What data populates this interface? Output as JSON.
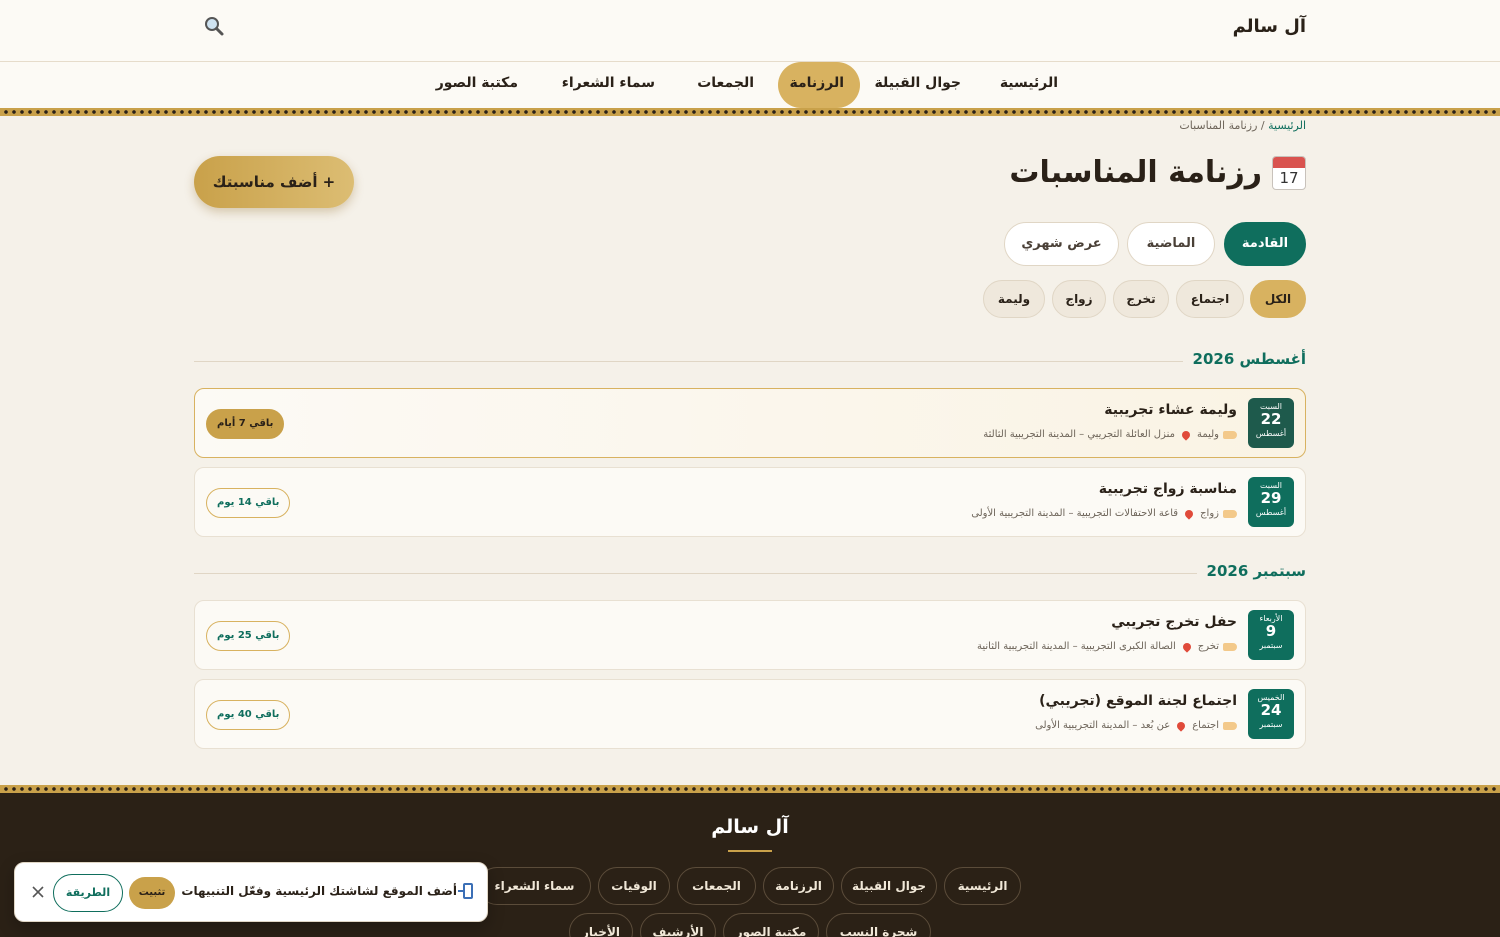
{
  "header": {
    "brand": "آل سالم",
    "nav": [
      "الرئيسية",
      "جوال القبيلة",
      "الرزنامة",
      "الجمعات",
      "سماء الشعراء",
      "مكتبة الصور"
    ]
  },
  "breadcrumb": {
    "home": "الرئيسية",
    "separator": " / ",
    "current": "رزنامة المناسبات"
  },
  "page": {
    "title": "رزنامة المناسبات",
    "calendar_icon_day": "17",
    "add_button": "+ أضف مناسبتك"
  },
  "tabs": [
    "القادمة",
    "الماضية",
    "عرض شهري"
  ],
  "filters": [
    "الكل",
    "اجتماع",
    "تخرج",
    "زواج",
    "وليمة"
  ],
  "months": [
    {
      "label": "أغسطس 2026",
      "events": [
        {
          "day": "السبت",
          "date": "22",
          "month": "أغسطس",
          "title": "وليمة عشاء تجريبية",
          "type": "وليمة",
          "location": "منزل العائلة التجريبي – المدينة التجريبية الثالثة",
          "countdown": "باقي 7 أيام"
        },
        {
          "day": "السبت",
          "date": "29",
          "month": "أغسطس",
          "title": "مناسبة زواج تجريبية",
          "type": "زواج",
          "location": "قاعة الاحتفالات التجريبية – المدينة التجريبية الأولى",
          "countdown": "باقي 14 يوم"
        }
      ]
    },
    {
      "label": "سبتمبر 2026",
      "events": [
        {
          "day": "الأربعاء",
          "date": "9",
          "month": "سبتمبر",
          "title": "حفل تخرج تجريبي",
          "type": "تخرج",
          "location": "الصالة الكبرى التجريبية – المدينة التجريبية الثانية",
          "countdown": "باقي 25 يوم"
        },
        {
          "day": "الخميس",
          "date": "24",
          "month": "سبتمبر",
          "title": "اجتماع لجنة الموقع (تجريبي)",
          "type": "اجتماع",
          "location": "عن بُعد – المدينة التجريبية الأولى",
          "countdown": "باقي 40 يوم"
        }
      ]
    }
  ],
  "footer": {
    "brand": "آل سالم",
    "links_row1": [
      "الرئيسية",
      "جوال القبيلة",
      "الرزنامة",
      "الجمعات",
      "الوفيات",
      "سماء الشعراء"
    ],
    "links_row2": [
      "شجرة النسب",
      "مكتبة الصور",
      "الأرشيف",
      "الأخبار"
    ]
  },
  "install_banner": {
    "text": "أضف الموقع لشاشتك الرئيسية وفعّل التنبيهات",
    "install_label": "تثبيت",
    "howto_label": "الطريقة"
  },
  "colors": {
    "primary": "#0f6e5d",
    "gold": "#c9a14a",
    "footer_bg": "#2b2116",
    "page_bg": "#f5f1e9"
  }
}
